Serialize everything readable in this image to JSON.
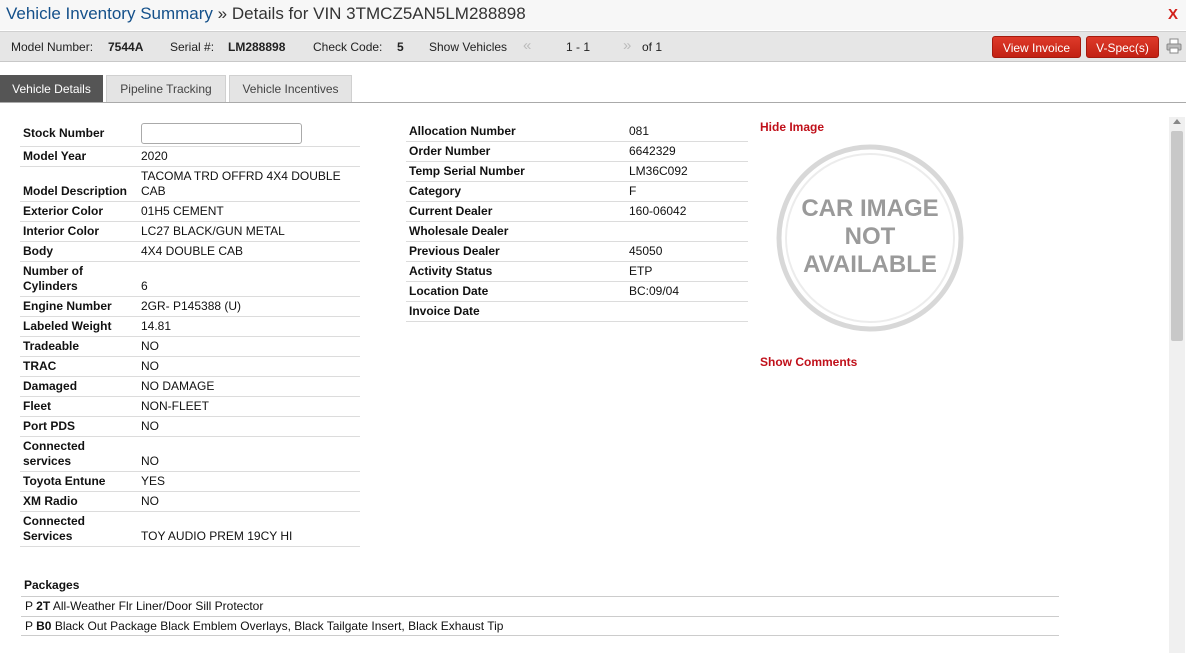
{
  "header": {
    "title_link": "Vehicle Inventory Summary",
    "title_sep": "»",
    "title_rest": "Details for VIN 3TMCZ5AN5LM288898",
    "close_label": "X"
  },
  "infobar": {
    "model_label": "Model Number:",
    "model_value": "7544A",
    "serial_label": "Serial #:",
    "serial_value": "LM288898",
    "check_label": "Check Code:",
    "check_value": "5",
    "show_label": "Show Vehicles",
    "prev_arrow": "«",
    "range": "1 - 1",
    "next_arrow": "»",
    "of_text": "of 1",
    "view_invoice": "View Invoice",
    "vspec": "V-Spec(s)"
  },
  "tabs": [
    "Vehicle Details",
    "Pipeline Tracking",
    "Vehicle Incentives"
  ],
  "left_details": {
    "stock_label": "Stock Number",
    "stock_value": "",
    "rows": [
      {
        "label": "Model Year",
        "value": "2020"
      },
      {
        "label": "Model Description",
        "value": "TACOMA TRD OFFRD 4X4 DOUBLE CAB"
      },
      {
        "label": "Exterior Color",
        "value": "01H5 CEMENT"
      },
      {
        "label": "Interior Color",
        "value": "LC27 BLACK/GUN METAL"
      },
      {
        "label": "Body",
        "value": "4X4 DOUBLE CAB"
      },
      {
        "label": "Number of Cylinders",
        "value": "6"
      },
      {
        "label": "Engine Number",
        "value": "2GR- P145388 (U)"
      },
      {
        "label": "Labeled Weight",
        "value": "14.81"
      },
      {
        "label": "Tradeable",
        "value": "NO"
      },
      {
        "label": "TRAC",
        "value": "NO"
      },
      {
        "label": "Damaged",
        "value": "NO DAMAGE"
      },
      {
        "label": "Fleet",
        "value": "NON-FLEET"
      },
      {
        "label": "Port PDS",
        "value": "NO"
      },
      {
        "label": "Connected services",
        "value": "NO"
      },
      {
        "label": "Toyota Entune",
        "value": "YES"
      },
      {
        "label": "XM Radio",
        "value": "NO"
      },
      {
        "label": "Connected Services",
        "value": "TOY AUDIO PREM 19CY HI"
      }
    ]
  },
  "mid_details": {
    "rows": [
      {
        "label": "Allocation Number",
        "value": "081"
      },
      {
        "label": "Order Number",
        "value": "6642329"
      },
      {
        "label": "Temp Serial Number",
        "value": "LM36C092"
      },
      {
        "label": "Category",
        "value": "F"
      },
      {
        "label": "Current Dealer",
        "value": "160-06042"
      },
      {
        "label": "Wholesale Dealer",
        "value": ""
      },
      {
        "label": "Previous Dealer",
        "value": "45050"
      },
      {
        "label": "Activity Status",
        "value": "ETP"
      },
      {
        "label": "Location Date",
        "value": "BC:09/04"
      },
      {
        "label": "Invoice Date",
        "value": ""
      }
    ]
  },
  "image_panel": {
    "hide_image": "Hide Image",
    "placeholder_lines": [
      "CAR IMAGE",
      "NOT",
      "AVAILABLE"
    ],
    "show_comments": "Show Comments"
  },
  "packages": {
    "title": "Packages",
    "items": [
      {
        "prefix": "P",
        "code": "2T",
        "desc": "All-Weather Flr Liner/Door Sill Protector"
      },
      {
        "prefix": "P",
        "code": "B0",
        "desc": "Black Out Package Black Emblem Overlays, Black Tailgate Insert, Black Exhaust Tip"
      }
    ]
  },
  "colors": {
    "link_blue": "#14508a",
    "accent_red": "#c22113",
    "tab_active": "#555555"
  },
  "icons": {
    "print": "printer-icon",
    "close": "close-icon"
  }
}
